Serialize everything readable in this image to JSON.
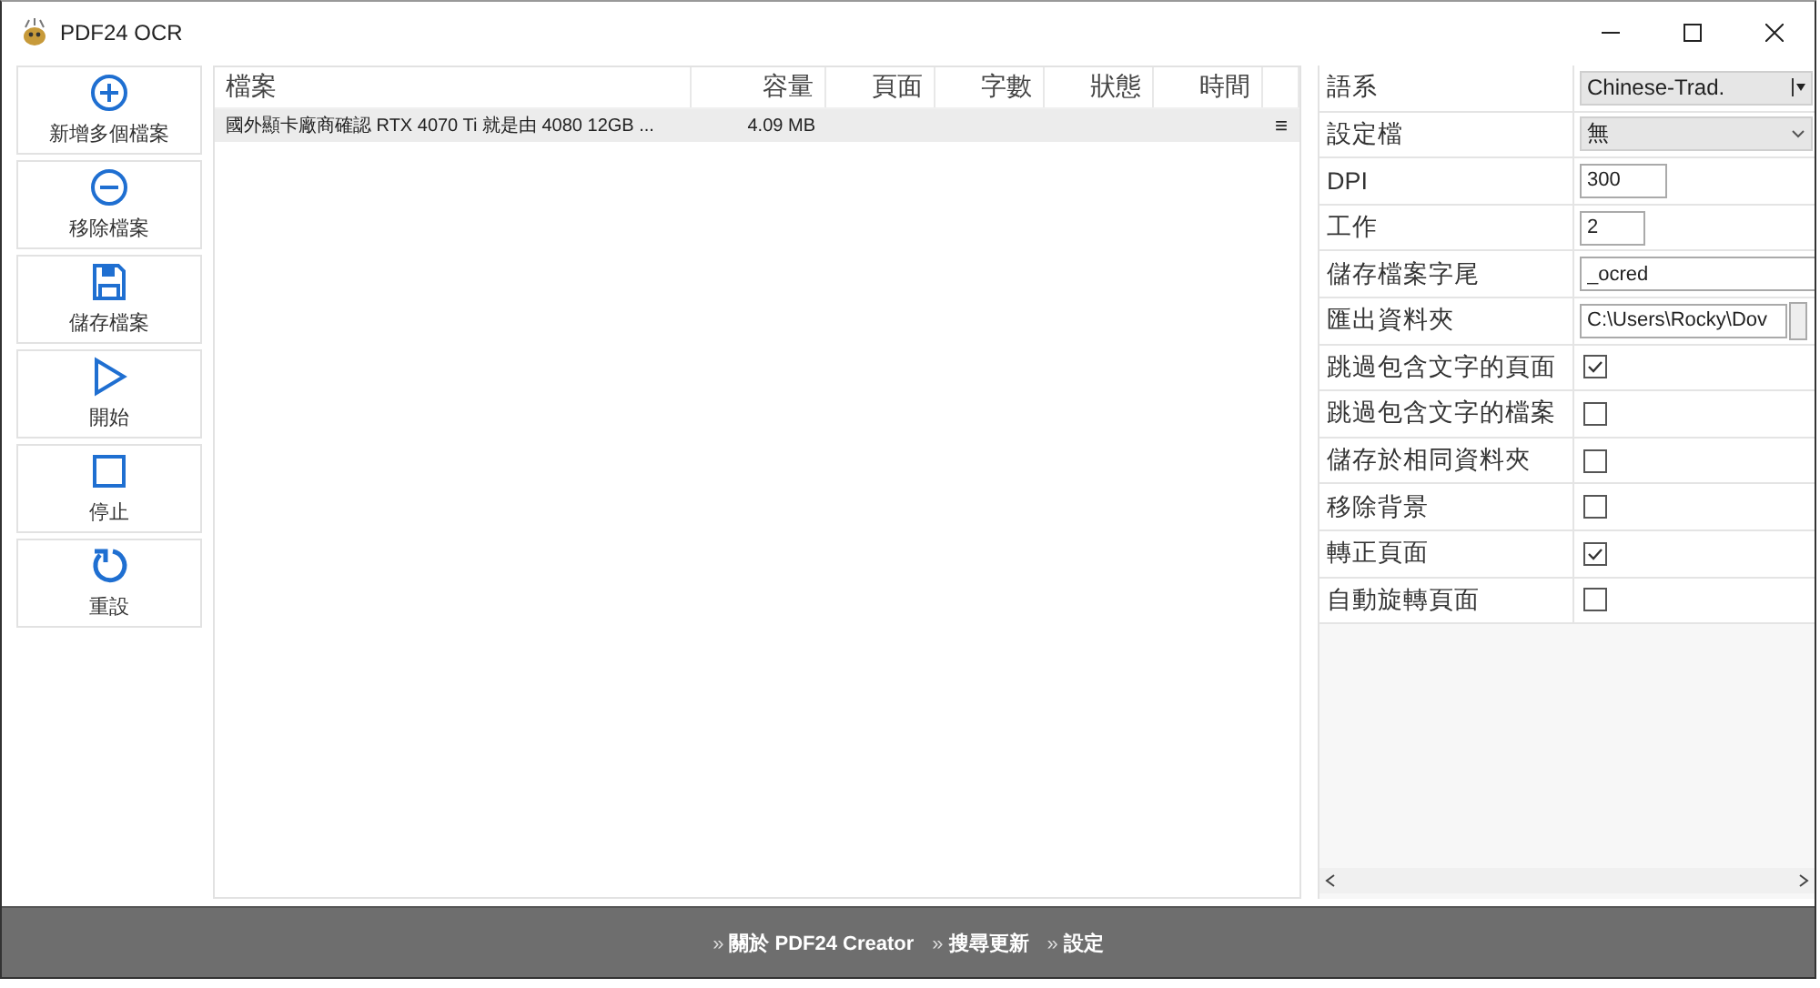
{
  "window": {
    "title": "PDF24 OCR"
  },
  "toolbar": [
    {
      "kind": "add",
      "label": "新增多個檔案"
    },
    {
      "kind": "remove",
      "label": "移除檔案"
    },
    {
      "kind": "save",
      "label": "儲存檔案"
    },
    {
      "kind": "start",
      "label": "開始"
    },
    {
      "kind": "stop",
      "label": "停止"
    },
    {
      "kind": "reset",
      "label": "重設"
    }
  ],
  "table": {
    "columns": [
      "檔案",
      "容量",
      "頁面",
      "字數",
      "狀態",
      "時間"
    ],
    "rows": [
      {
        "selected": true,
        "cells": [
          "國外顯卡廠商確認 RTX 4070 Ti 就是由 4080 12GB ...",
          "4.09 MB",
          "",
          "",
          "",
          ""
        ],
        "menu": "≡"
      }
    ]
  },
  "properties": [
    {
      "kind": "dropdown",
      "label": "語系",
      "value": "Chinese-Trad."
    },
    {
      "kind": "combo",
      "label": "設定檔",
      "value": "無"
    },
    {
      "kind": "input",
      "label": "DPI",
      "value": "300"
    },
    {
      "kind": "input",
      "label": "工作",
      "value": "2"
    },
    {
      "kind": "wide",
      "label": "儲存檔案字尾",
      "value": "_ocred"
    },
    {
      "kind": "path",
      "label": "匯出資料夾",
      "value": "C:\\Users\\Rocky\\Dov"
    },
    {
      "kind": "checkbox",
      "label": "跳過包含文字的頁面",
      "checked": true
    },
    {
      "kind": "checkbox",
      "label": "跳過包含文字的檔案",
      "checked": false
    },
    {
      "kind": "checkbox",
      "label": "儲存於相同資料夾",
      "checked": false
    },
    {
      "kind": "checkbox",
      "label": "移除背景",
      "checked": false
    },
    {
      "kind": "checkbox",
      "label": "轉正頁面",
      "checked": true
    },
    {
      "kind": "checkbox",
      "label": "自動旋轉頁面",
      "checked": false
    }
  ],
  "footer": [
    {
      "marker": "»",
      "label": "關於 PDF24 Creator"
    },
    {
      "marker": "»",
      "label": "搜尋更新"
    },
    {
      "marker": "»",
      "label": "設定"
    }
  ]
}
